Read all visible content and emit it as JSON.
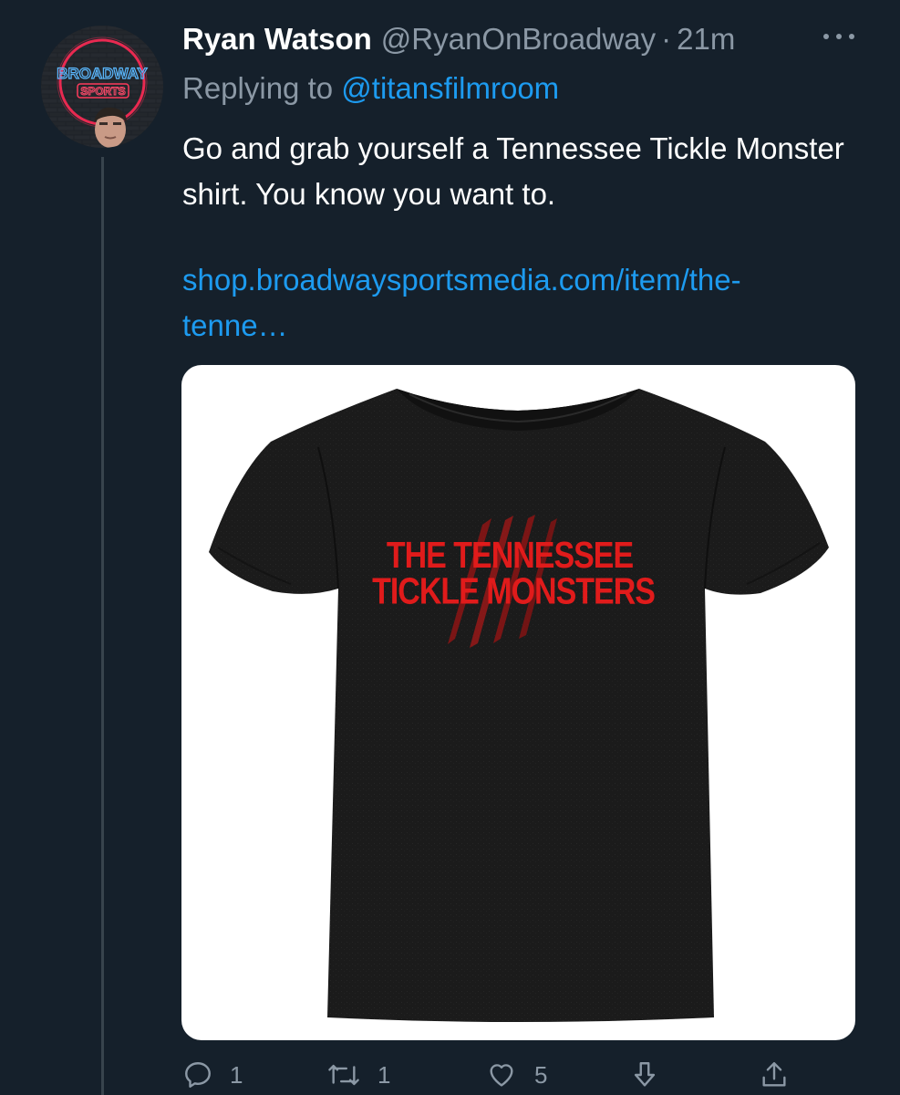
{
  "tweet": {
    "author_name": "Ryan Watson",
    "author_handle": "@RyanOnBroadway",
    "separator": "·",
    "time": "21m",
    "reply_prefix": "Replying to",
    "reply_mention": "@titansfilmroom",
    "text": "Go and grab yourself a Tennessee Tickle Monster shirt. You know you want to.",
    "link_line1": "shop.broadwaysportsmedia.com/item/the-",
    "link_line2": "tenne…"
  },
  "avatar": {
    "sign_line1": "BROADWAY",
    "sign_line2": "SPORTS"
  },
  "media": {
    "shirt_line1": "THE TENNESSEE",
    "shirt_line2": "TICKLE MONSTERS"
  },
  "actions": {
    "reply_count": "1",
    "retweet_count": "1",
    "like_count": "5"
  },
  "colors": {
    "background": "#15202b",
    "text_secondary": "#8b98a5",
    "link": "#1d9bf0",
    "shirt_print": "#e01b1b"
  }
}
